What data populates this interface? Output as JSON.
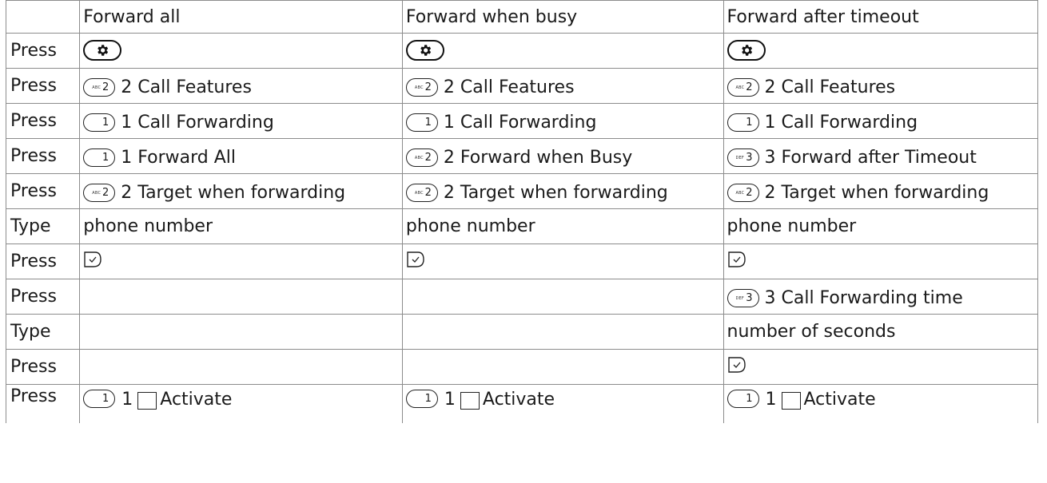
{
  "headers": [
    "",
    "Forward all",
    "Forward when busy",
    "Forward after timeout"
  ],
  "rows": [
    {
      "action": "Press",
      "cells": [
        {
          "key": "settings-icon"
        },
        {
          "key": "settings-icon"
        },
        {
          "key": "settings-icon"
        }
      ]
    },
    {
      "action": "Press",
      "cells": [
        {
          "key": "2",
          "sub": "ABC",
          "text": "2 Call Features"
        },
        {
          "key": "2",
          "sub": "ABC",
          "text": "2 Call Features"
        },
        {
          "key": "2",
          "sub": "ABC",
          "text": "2 Call Features"
        }
      ]
    },
    {
      "action": "Press",
      "cells": [
        {
          "key": "1",
          "sub": "",
          "text": "1 Call Forwarding"
        },
        {
          "key": "1",
          "sub": "",
          "text": "1 Call Forwarding"
        },
        {
          "key": "1",
          "sub": "",
          "text": "1 Call Forwarding"
        }
      ]
    },
    {
      "action": "Press",
      "cells": [
        {
          "key": "1",
          "sub": "",
          "text": "1 Forward All"
        },
        {
          "key": "2",
          "sub": "ABC",
          "text": "2 Forward when Busy"
        },
        {
          "key": "3",
          "sub": "DEF",
          "text": "3 Forward after Timeout"
        }
      ]
    },
    {
      "action": "Press",
      "cells": [
        {
          "key": "2",
          "sub": "ABC",
          "text": "2 Target when forwarding"
        },
        {
          "key": "2",
          "sub": "ABC",
          "text": "2 Target when forwarding"
        },
        {
          "key": "2",
          "sub": "ABC",
          "text": "2 Target when forwarding"
        }
      ]
    },
    {
      "action": "Type",
      "cells": [
        {
          "text": "phone number"
        },
        {
          "text": "phone number"
        },
        {
          "text": "phone number"
        }
      ]
    },
    {
      "action": "Press",
      "cells": [
        {
          "key": "ok-check-icon"
        },
        {
          "key": "ok-check-icon"
        },
        {
          "key": "ok-check-icon"
        }
      ]
    },
    {
      "action": "Press",
      "cells": [
        {},
        {},
        {
          "key": "3",
          "sub": "DEF",
          "text": "3 Call Forwarding time"
        }
      ]
    },
    {
      "action": "Type",
      "cells": [
        {},
        {},
        {
          "text": "number of seconds"
        }
      ]
    },
    {
      "action": "Press",
      "cells": [
        {},
        {},
        {
          "key": "ok-check-icon"
        }
      ]
    },
    {
      "action": "Press",
      "cells": [
        {
          "key": "1",
          "sub": "",
          "num": "1",
          "text": "Activate"
        },
        {
          "key": "1",
          "sub": "",
          "num": "1",
          "text": "Activate"
        },
        {
          "key": "1",
          "sub": "",
          "num": "1",
          "text": "Activate"
        }
      ]
    }
  ]
}
